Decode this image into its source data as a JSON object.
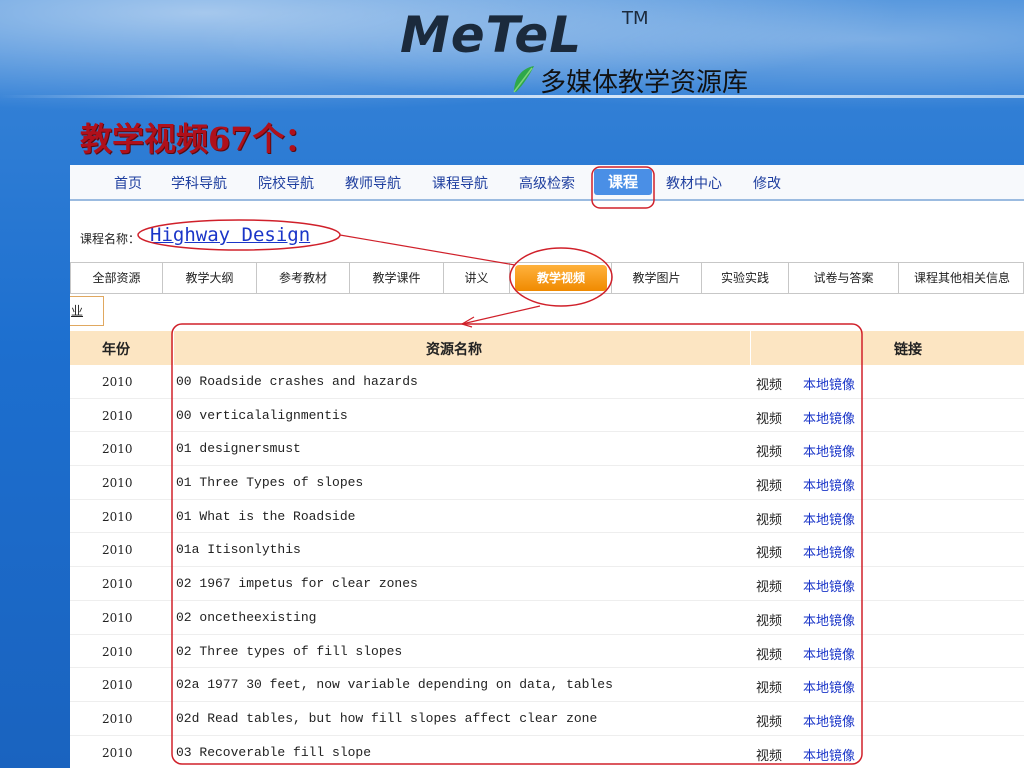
{
  "logo": {
    "main": "MeTeL",
    "tm": "TM",
    "subtitle": "多媒体教学资源库"
  },
  "slide_title": "教学视频67个：",
  "nav": {
    "items": [
      "首页",
      "学科导航",
      "院校导航",
      "教师导航",
      "课程导航",
      "高级检索",
      "课程",
      "教材中心",
      "修改"
    ],
    "active": "课程"
  },
  "course": {
    "label": "课程名称：",
    "name": "Highway Design"
  },
  "subtabs": {
    "items": [
      "全部资源",
      "教学大纲",
      "参考教材",
      "教学课件",
      "讲义",
      "教学视频",
      "教学图片",
      "实验实践",
      "试卷与答案",
      "课程其他相关信息"
    ],
    "active": "教学视频"
  },
  "mini_box": "业",
  "table": {
    "headers": {
      "year": "年份",
      "name": "资源名称",
      "link": "链接"
    },
    "rows": [
      {
        "year": "2010",
        "name": "00 Roadside crashes and hazards",
        "type": "视频",
        "link": "本地镜像"
      },
      {
        "year": "2010",
        "name": "00 verticalalignmentis",
        "type": "视频",
        "link": "本地镜像"
      },
      {
        "year": "2010",
        "name": "01 designersmust",
        "type": "视频",
        "link": "本地镜像"
      },
      {
        "year": "2010",
        "name": "01 Three Types of slopes",
        "type": "视频",
        "link": "本地镜像"
      },
      {
        "year": "2010",
        "name": "01 What is the Roadside",
        "type": "视频",
        "link": "本地镜像"
      },
      {
        "year": "2010",
        "name": "01a Itisonlythis",
        "type": "视频",
        "link": "本地镜像"
      },
      {
        "year": "2010",
        "name": "02 1967 impetus for clear zones",
        "type": "视频",
        "link": "本地镜像"
      },
      {
        "year": "2010",
        "name": "02 oncetheexisting",
        "type": "视频",
        "link": "本地镜像"
      },
      {
        "year": "2010",
        "name": "02 Three types of fill slopes",
        "type": "视频",
        "link": "本地镜像"
      },
      {
        "year": "2010",
        "name": "02a 1977 30 feet, now variable depending on data, tables",
        "type": "视频",
        "link": "本地镜像"
      },
      {
        "year": "2010",
        "name": "02d Read tables, but how fill slopes affect clear zone",
        "type": "视频",
        "link": "本地镜像"
      },
      {
        "year": "2010",
        "name": "03 Recoverable fill slope",
        "type": "视频",
        "link": "本地镜像"
      }
    ]
  },
  "colors": {
    "title": "#b0101b",
    "link": "#1a35c8",
    "annotation": "#d0202a",
    "active_tab": "#f08a00"
  }
}
